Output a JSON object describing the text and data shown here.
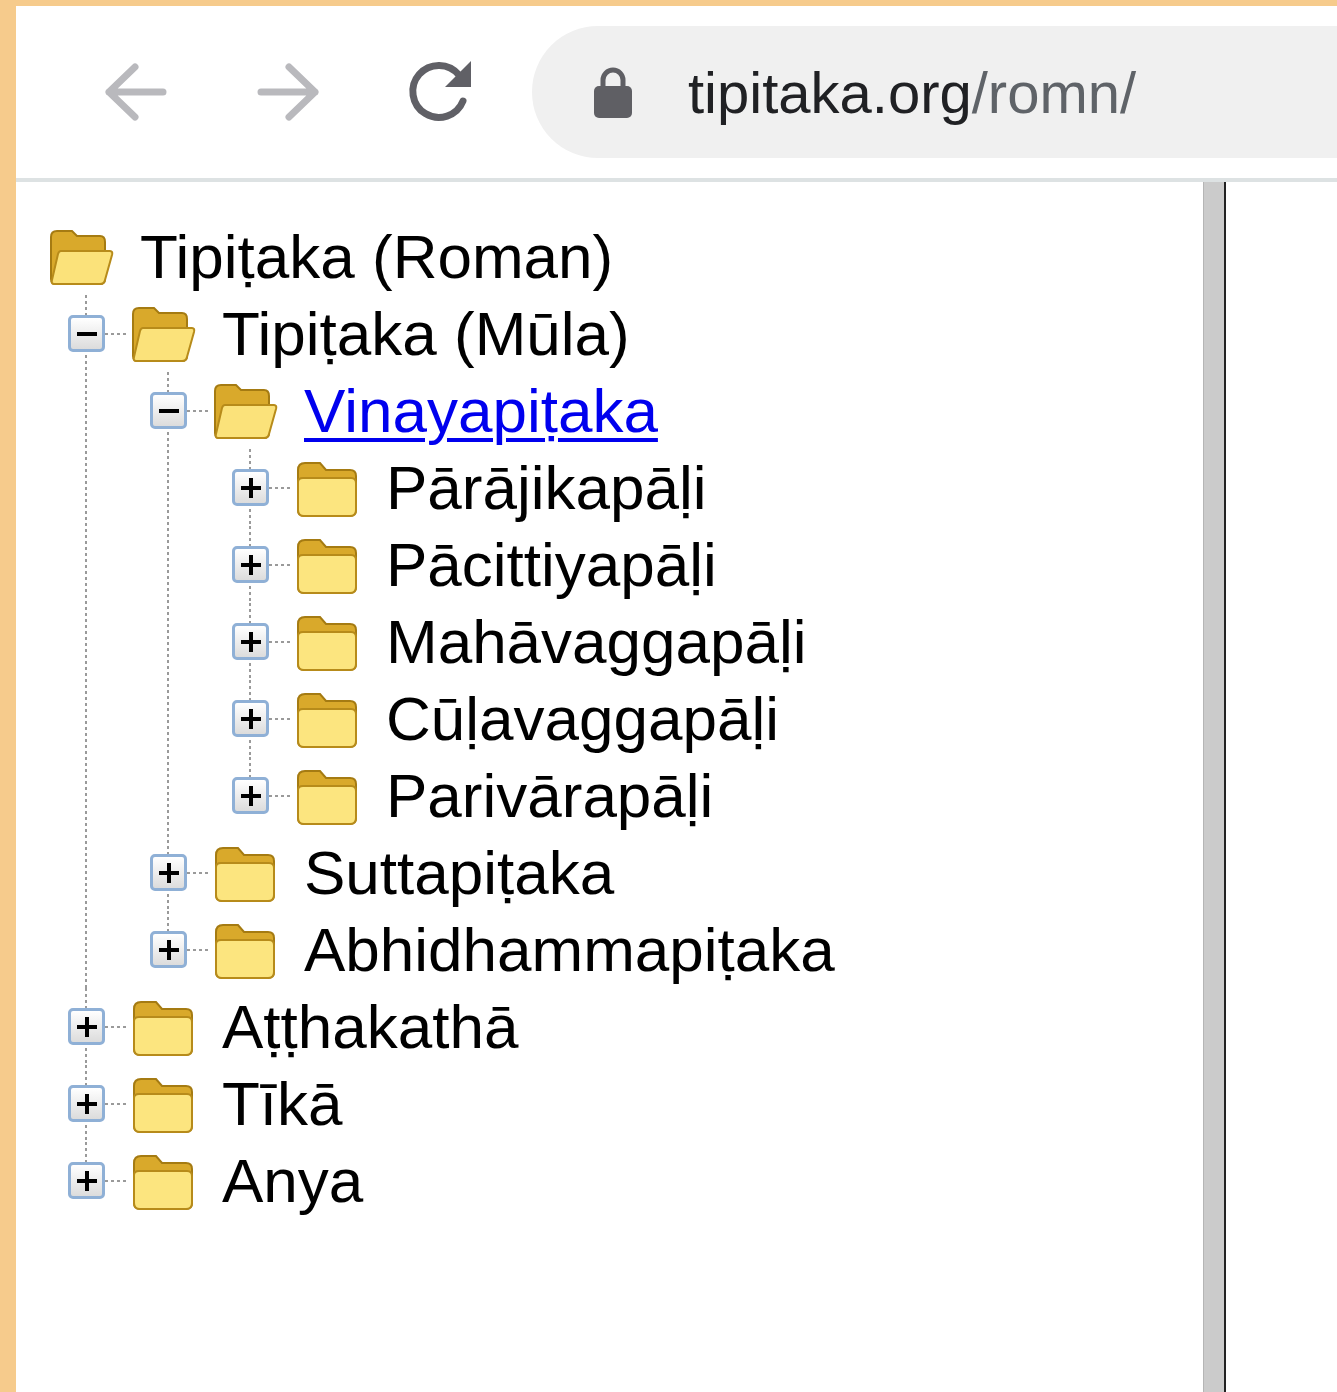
{
  "toolbar": {
    "buttons": [
      {
        "kind": "back",
        "disabled": true
      },
      {
        "kind": "forward",
        "disabled": true
      },
      {
        "kind": "reload",
        "disabled": false
      }
    ],
    "address": {
      "host": "tipitaka.org",
      "path": "/romn/",
      "secure": true
    }
  },
  "tree": {
    "label": "Tipiṭaka (Roman)",
    "expanded": true,
    "kind": "text",
    "children": [
      {
        "label": "Tipiṭaka (Mūla)",
        "expanded": true,
        "kind": "text",
        "children": [
          {
            "label": "Vinayapiṭaka",
            "expanded": true,
            "kind": "link",
            "children": [
              {
                "label": "Pārājikapāḷi",
                "expanded": false,
                "kind": "text"
              },
              {
                "label": "Pācittiyapāḷi",
                "expanded": false,
                "kind": "text"
              },
              {
                "label": "Mahāvaggapāḷi",
                "expanded": false,
                "kind": "text"
              },
              {
                "label": "Cūḷavaggapāḷi",
                "expanded": false,
                "kind": "text"
              },
              {
                "label": "Parivārapāḷi",
                "expanded": false,
                "kind": "text"
              }
            ]
          },
          {
            "label": "Suttapiṭaka",
            "expanded": false,
            "kind": "text"
          },
          {
            "label": "Abhidhammapiṭaka",
            "expanded": false,
            "kind": "text"
          }
        ]
      },
      {
        "label": "Aṭṭhakathā",
        "expanded": false,
        "kind": "text"
      },
      {
        "label": "Tīkā",
        "expanded": false,
        "kind": "text"
      },
      {
        "label": "Anya",
        "expanded": false,
        "kind": "text"
      }
    ]
  }
}
